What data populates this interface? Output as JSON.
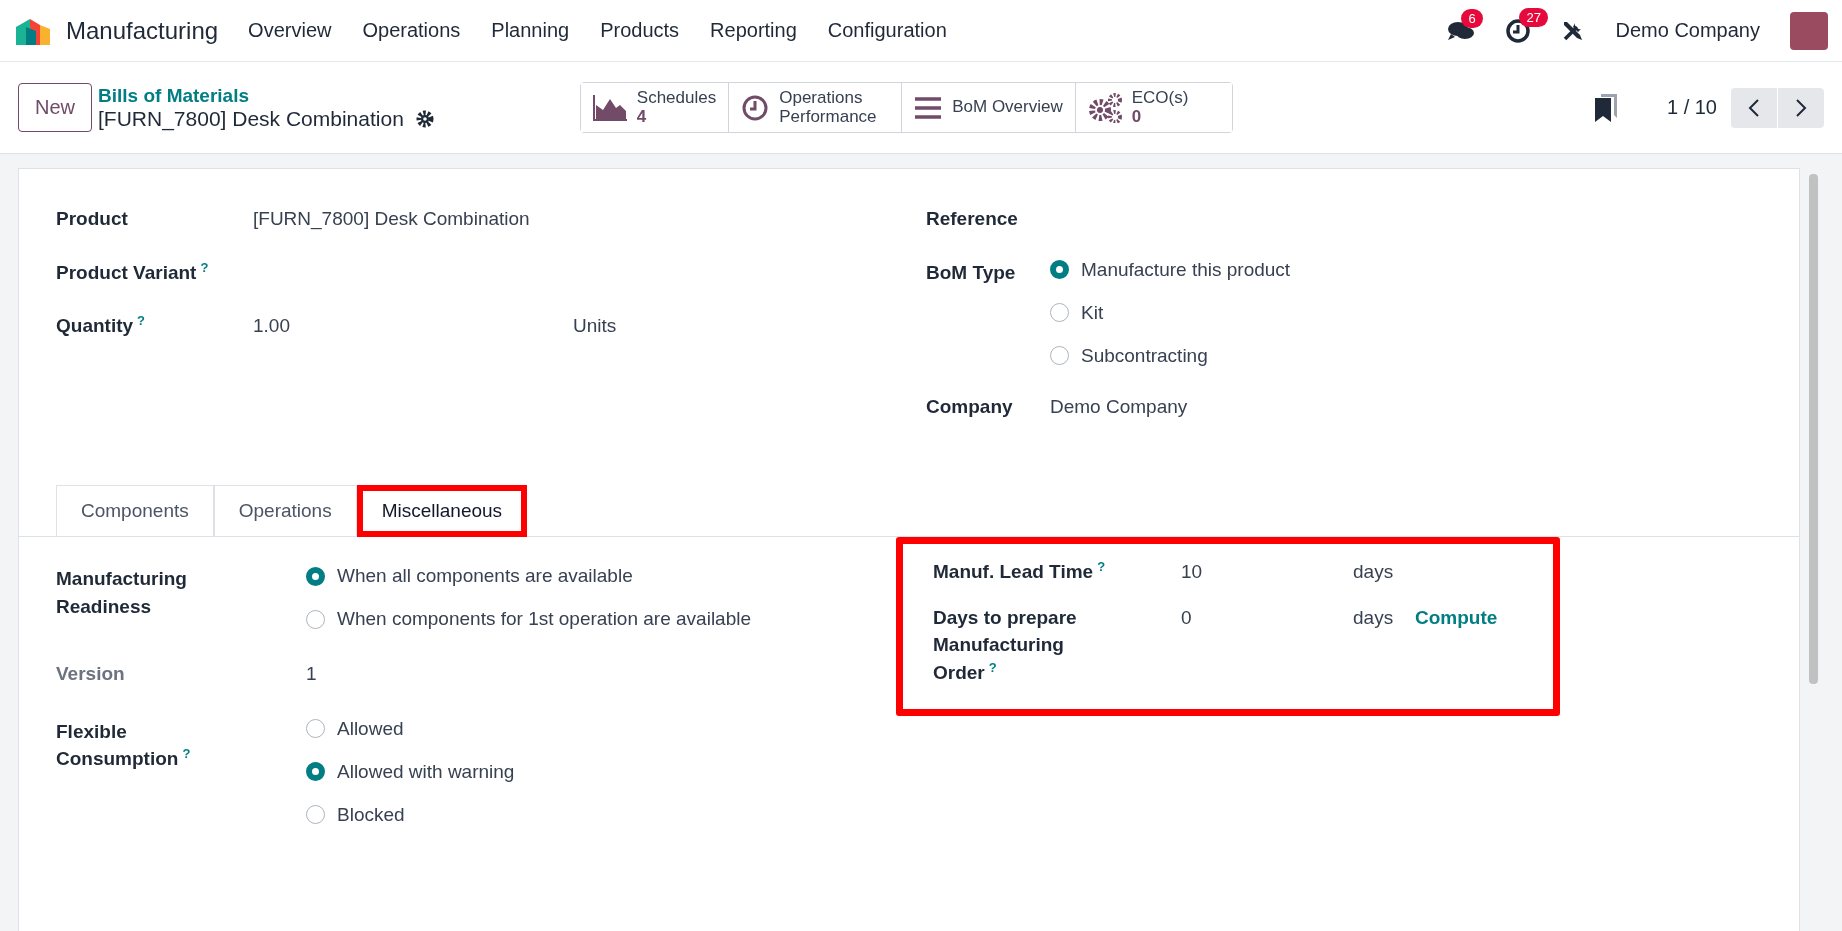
{
  "navbar": {
    "app_name": "Manufacturing",
    "menu": [
      "Overview",
      "Operations",
      "Planning",
      "Products",
      "Reporting",
      "Configuration"
    ],
    "messages_count": "6",
    "activities_count": "27",
    "company": "Demo Company"
  },
  "control_panel": {
    "new_button": "New",
    "breadcrumb": "Bills of Materials",
    "record_title": "[FURN_7800] Desk Combination",
    "smart_buttons": [
      {
        "kind": "stat",
        "label": "Schedules",
        "value": "4"
      },
      {
        "kind": "text",
        "label": "Operations Performance"
      },
      {
        "kind": "text",
        "label": "BoM Overview"
      },
      {
        "kind": "stat",
        "label": "ECO(s)",
        "value": "0"
      }
    ],
    "pager": "1 / 10"
  },
  "form": {
    "left_fields": [
      {
        "label": "Product",
        "value": "[FURN_7800] Desk Combination"
      },
      {
        "label": "Product Variant",
        "help": "?"
      },
      {
        "label": "Quantity",
        "help": "?",
        "value": "1.00",
        "unit": "Units"
      }
    ],
    "reference_label": "Reference",
    "bom_type": {
      "label": "BoM Type",
      "options": [
        {
          "label": "Manufacture this product",
          "selected": true
        },
        {
          "label": "Kit",
          "selected": false
        },
        {
          "label": "Subcontracting",
          "selected": false
        }
      ]
    },
    "company": {
      "label": "Company",
      "value": "Demo Company"
    }
  },
  "tabs": [
    {
      "label": "Components",
      "selected": false,
      "highlighted": false
    },
    {
      "label": "Operations",
      "selected": false,
      "highlighted": false
    },
    {
      "label": "Miscellaneous",
      "selected": true,
      "highlighted": true
    }
  ],
  "miscellaneous": {
    "readiness": {
      "label": "Manufacturing Readiness",
      "options": [
        {
          "label": "When all components are available",
          "selected": true
        },
        {
          "label": "When components for 1st operation are available",
          "selected": false
        }
      ]
    },
    "version": {
      "label": "Version",
      "value": "1",
      "muted": true
    },
    "consumption": {
      "label": "Flexible Consumption",
      "help": "?",
      "options": [
        {
          "label": "Allowed",
          "selected": false
        },
        {
          "label": "Allowed with warning",
          "selected": true
        },
        {
          "label": "Blocked",
          "selected": false
        }
      ]
    },
    "lead_times": {
      "highlighted": true,
      "rows": [
        {
          "label": "Manuf. Lead Time",
          "help": "?",
          "value": "10",
          "unit": "days"
        },
        {
          "label": "Days to prepare Manufacturing Order",
          "help": "?",
          "value": "0",
          "unit": "days",
          "action": "Compute"
        }
      ]
    }
  }
}
